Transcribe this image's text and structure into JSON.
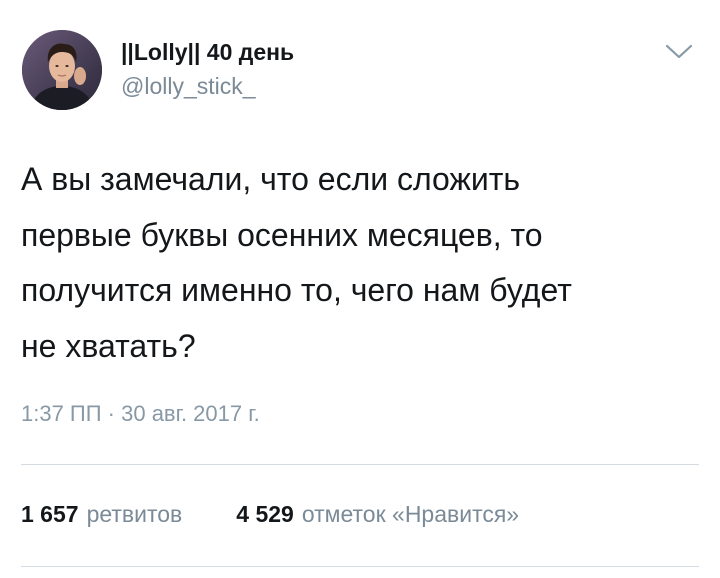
{
  "author": {
    "display_name": "||Lolly|| 40 день",
    "handle": "@lolly_stick_",
    "avatar_icon": "user-avatar-photo"
  },
  "menu": {
    "icon": "chevron-down-icon"
  },
  "tweet": {
    "text": "А вы замечали, что если сложить\nпервые буквы осенних месяцев, то\nполучится именно то, чего нам будет\nне хватать?",
    "timestamp": "1:37 ПП · 30 авг. 2017 г."
  },
  "stats": {
    "retweets_count": "1 657",
    "retweets_label": "ретвитов",
    "likes_count": "4 529",
    "likes_label": "отметок «Нравится»"
  },
  "colors": {
    "text": "#14171a",
    "secondary": "#7b8a97",
    "divider": "#d4dbe1"
  }
}
